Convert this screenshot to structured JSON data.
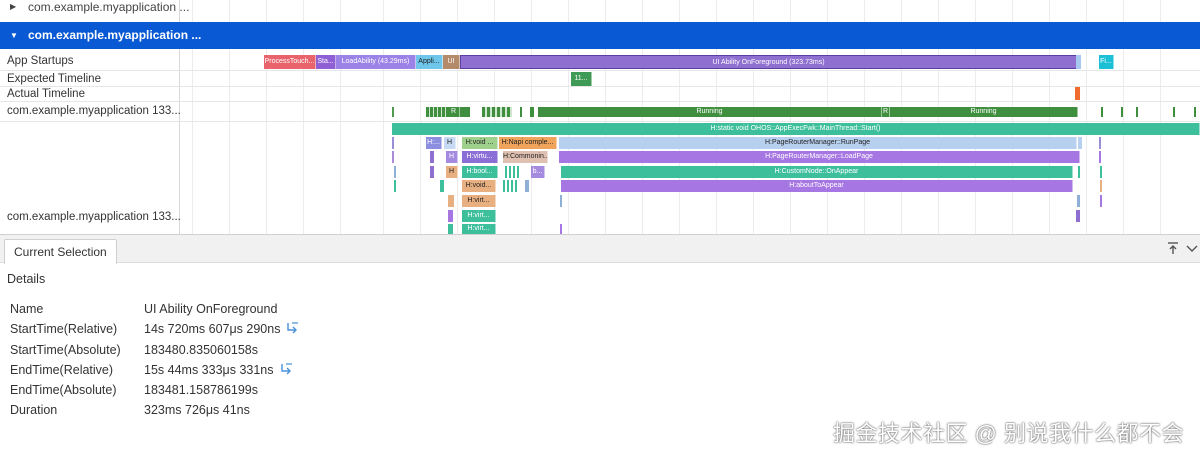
{
  "processes": {
    "collapsed_title": "com.example.myapplication ...",
    "expanded_title": "com.example.myapplication ..."
  },
  "lanes": {
    "app_startups": "App Startups",
    "expected_timeline": "Expected Timeline",
    "actual_timeline": "Actual Timeline",
    "thread_1": "com.example.myapplication 133...",
    "thread_2": "com.example.myapplication 133..."
  },
  "slices": {
    "process_touch": "ProcessTouch...",
    "sta": "Sta...",
    "load_ability": "LoadAbility (43.29ms)",
    "appli": "Appli...",
    "ui_short": "UI",
    "ui_foreground": "UI Ability OnForeground (323.73ms)",
    "fi": "Fi...",
    "expected_11": "11...",
    "running_1": "Running",
    "r_marker": "R",
    "running_2": "Running",
    "main_start": "H:static void OHOS::AppExecFwk::MainThread::Start()",
    "h_dots": "H:...",
    "h_single": "H",
    "h_void_1": "H:void ...",
    "h_napi": "H:Napi comple...",
    "run_page": "H:PageRouterManager::RunPage",
    "h_virtu": "H:virtu...",
    "h_commonin": "H:Commonin...",
    "load_page": "H:PageRouterManager::LoadPage",
    "h_bool": "H:bool...",
    "h_b": "b...",
    "on_appear": "H:CustomNode::OnAppear",
    "h_void_2": "H:void...",
    "about_to_appear": "H:aboutToAppear",
    "h_virt_1": "H:virt...",
    "h_virt_2": "H:virt...",
    "h_virt_3": "H:virt..."
  },
  "panel": {
    "tab_label": "Current Selection",
    "details_heading": "Details",
    "rows": [
      {
        "key": "Name",
        "value": "UI Ability OnForeground"
      },
      {
        "key": "StartTime(Relative)",
        "value": "14s 720ms 607μs 290ns"
      },
      {
        "key": "StartTime(Absolute)",
        "value": "183480.835060158s"
      },
      {
        "key": "EndTime(Relative)",
        "value": "15s 44ms 333μs 331ns"
      },
      {
        "key": "EndTime(Absolute)",
        "value": "183481.158786199s"
      },
      {
        "key": "Duration",
        "value": "323ms 726μs 41ns"
      }
    ]
  },
  "icons": {
    "collapsed_caret": "caret-right-icon",
    "expanded_caret": "caret-down-icon",
    "jump": "jump-to-icon",
    "pin": "pin-to-top-icon",
    "chevron": "chevron-down-icon"
  },
  "watermark": "掘金技术社区 @ 别说我什么都不会",
  "colors": {
    "selected_process": "#0a59d4",
    "ui_foreground": "#8f6fcf",
    "running": "#3f8f3f",
    "main_thread": "#3dbf9c"
  }
}
